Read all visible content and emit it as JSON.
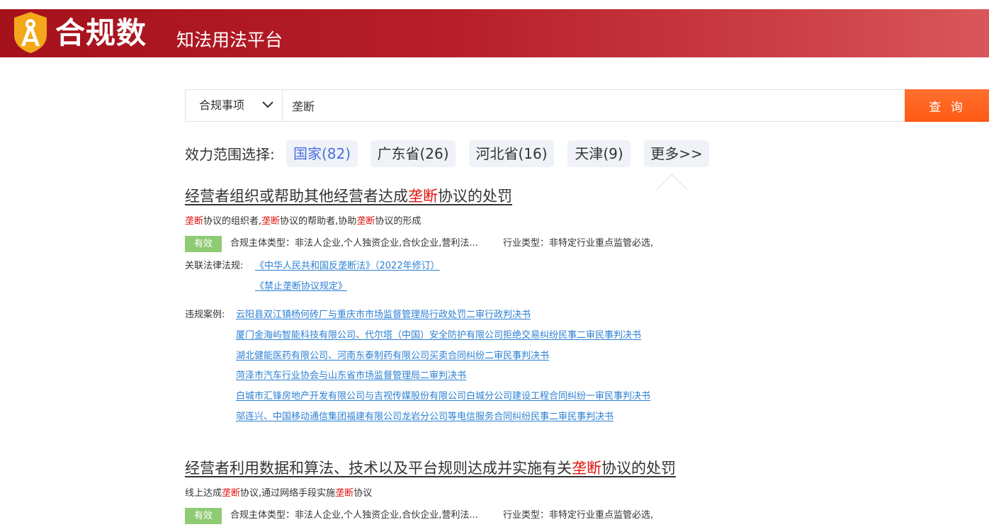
{
  "header": {
    "logo_text": "合规数",
    "subtitle": "知法用法平台"
  },
  "search": {
    "category": "合规事项",
    "query": "垄断",
    "button_label": "查 询"
  },
  "scope": {
    "label": "效力范围选择:",
    "chips": [
      "国家(82)",
      "广东省(26)",
      "河北省(16)",
      "天津(9)",
      "更多>>"
    ]
  },
  "results": [
    {
      "title_parts": [
        "经营者组织或帮助其他经营者达成",
        "垄断",
        "协议的处罚"
      ],
      "desc_parts": [
        "垄断",
        "协议的组织者,",
        "垄断",
        "协议的帮助者,协助",
        "垄断",
        "协议的形成"
      ],
      "status": "有效",
      "subject_type": "合规主体类型：非法人企业,个人独资企业,合伙企业,营利法...",
      "industry_type": "行业类型：非特定行业重点监管必选,",
      "law_label": "关联法律法规:",
      "laws": [
        "《中华人民共和国反垄断法》（2022年修订）",
        "《禁止垄断协议规定》"
      ],
      "cases_label": "违规案例:",
      "cases": [
        "云阳县双江镇杨何砖厂与重庆市市场监督管理局行政处罚二审行政判决书",
        "厦门金海屿智能科技有限公司、代尔塔（中国）安全防护有限公司拒绝交易纠纷民事二审民事判决书",
        "湖北健能医药有限公司、河南东泰制药有限公司买卖合同纠纷二审民事判决书",
        "菏泽市汽车行业协会与山东省市场监督管理局二审判决书",
        "白城市汇锋房地产开发有限公司与吉视传媒股份有限公司白城分公司建设工程合同纠纷一审民事判决书",
        "邬连兴、中国移动通信集团福建有限公司龙岩分公司等电信服务合同纠纷民事二审民事判决书"
      ]
    },
    {
      "title_parts": [
        "经营者利用数据和算法、技术以及平台规则达成并实施有关",
        "垄断",
        "协议的处罚"
      ],
      "desc_parts": [
        "线上达成",
        "垄断",
        "协议,通过网络手段实施",
        "垄断",
        "协议"
      ],
      "status": "有效",
      "subject_type": "合规主体类型：非法人企业,个人独资企业,合伙企业,营利法...",
      "industry_type": "行业类型：非特定行业重点监管必选,"
    }
  ],
  "colors": {
    "header_red": "#b61e29",
    "search_orange": "#ff5a14",
    "highlight_red": "#e0120c",
    "link_blue": "#2a7fd4",
    "chip_active_blue": "#4a6fe0",
    "badge_green": "#8fcb74"
  },
  "icons": {
    "logo": "shield-compass-icon",
    "dropdown": "chevron-down-icon"
  }
}
